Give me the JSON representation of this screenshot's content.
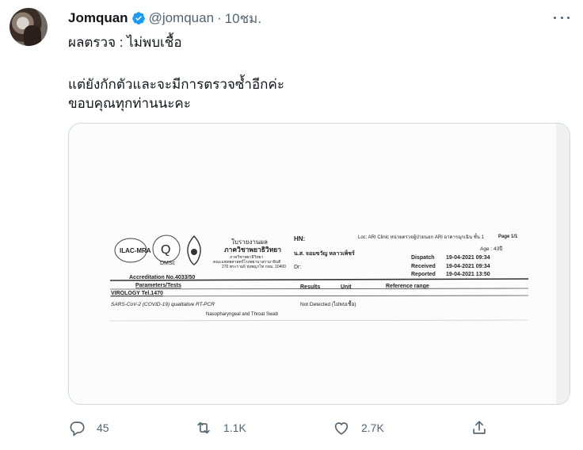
{
  "tweet": {
    "display_name": "Jomquan",
    "handle": "@jomquan",
    "separator": "·",
    "time": "10ชม.",
    "lines": [
      "ผลตรวจ : ไม่พบเชื้อ",
      "แต่ยังกักตัวและจะมีการตรวจซ้ำอีกค่ะ",
      "ขอบคุณทุกท่านนะคะ"
    ]
  },
  "report": {
    "hospital_title_1": "ใบรายงานผล",
    "hospital_title_2": "ภาควิชาพยาธิวิทยา",
    "address_1": "ภาควิชาพยาธิวิทยา",
    "address_2": "คณะแพทยศาสตร์โรงพยาบาลรามาธิบดี",
    "address_3": "270 พระราม6 ทุ่งพญาไท กทม. 10400",
    "logo_1": "ILAC-MRA",
    "logo_2": "Q",
    "logo_2_sub": "DMSc",
    "hn_label": "HN:",
    "loc": "Loc: ARI Clinic หน่วยตรวจผู้ป่วยนอก ARI อาคารฉุกเฉิน ชั้น 1",
    "page": "Page 1/1",
    "age": "Age :  43ปี",
    "patient": "น.ส. จอมขวัญ หลาวเพ็ชร์",
    "dr_label": "Dr:",
    "dispatch_label": "Dispatch",
    "dispatch_value": "19-04-2021 09:34",
    "received_label": "Received",
    "received_value": "19-04-2021 09:34",
    "reported_label": "Reported",
    "reported_value": "19-04-2021 13:50",
    "accreditation": "Accreditation No.4033/50",
    "col_params": "Parameters/Tests",
    "col_results": "Results",
    "col_unit": "Unit",
    "col_ref": "Reference range",
    "section": "VIROLOGY  Tel.1470",
    "test_name": "SARS-CoV-2 (COVID-19) qualitative RT-PCR",
    "test_result": "Not Detected (ไม่พบเชื้อ)",
    "specimen": "Nasopharyngeal and Throat Swab"
  },
  "actions": {
    "reply_count": "45",
    "retweet_count": "1.1K",
    "like_count": "2.7K"
  },
  "icons": {
    "verified": "verified-badge-icon",
    "reply": "reply-icon",
    "retweet": "retweet-icon",
    "like": "heart-icon",
    "share": "share-icon",
    "more": "more-icon"
  },
  "colors": {
    "verified_blue": "#1d9bf0",
    "secondary_text": "#536471",
    "border": "#cfd9de"
  }
}
